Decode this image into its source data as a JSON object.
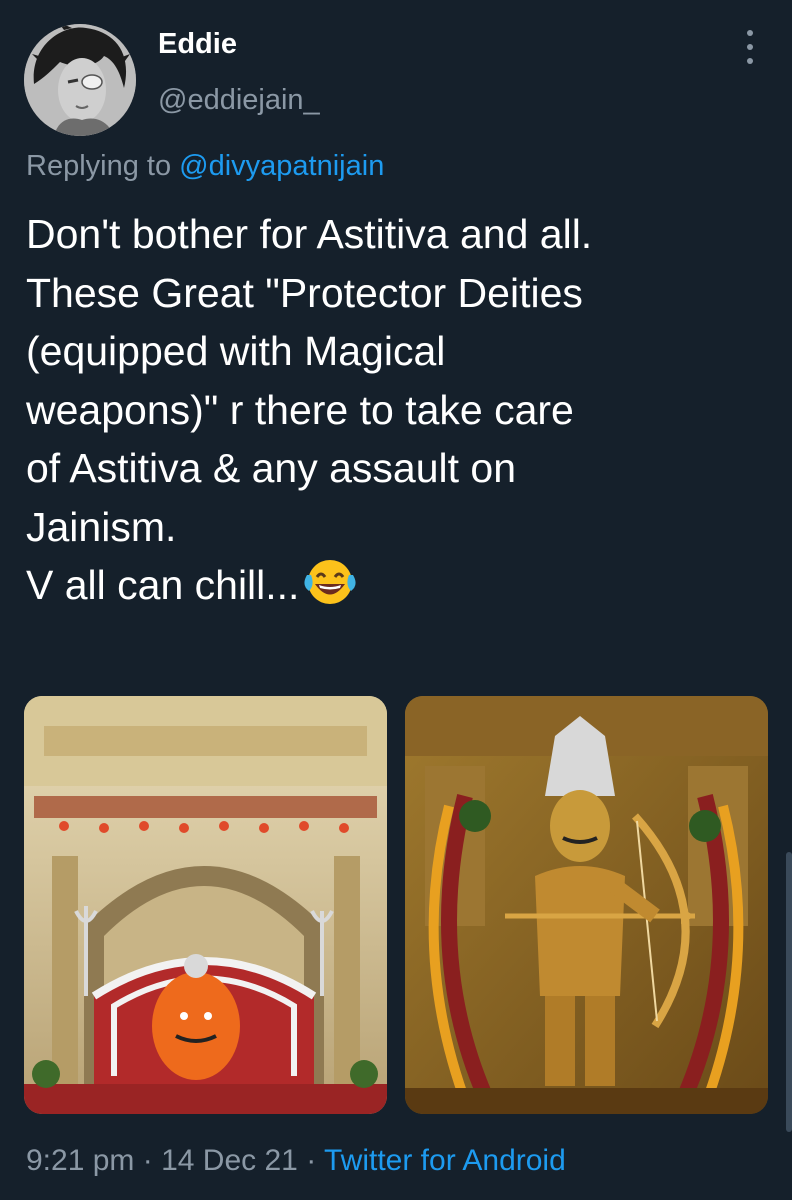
{
  "author": {
    "display_name": "Eddie",
    "handle": "@eddiejain_"
  },
  "reply": {
    "prefix": "Replying to",
    "mention": "@divyapatnijain"
  },
  "tweet": {
    "lines": [
      "Don't bother for Astitiva and all.",
      "These Great \"Protector Deities",
      "(equipped with Magical",
      "weapons)\" r there to take care",
      "of Astitiva & any assault on",
      "Jainism.",
      "V all can chill..."
    ],
    "emoji": "face-with-tears-of-joy"
  },
  "media": [
    {
      "name": "shrine-photo",
      "description_icon": "temple-shrine-image"
    },
    {
      "name": "deity-archer-photo",
      "description_icon": "golden-deity-with-bow-image"
    }
  ],
  "meta": {
    "time": "9:21 pm",
    "separator": "·",
    "date": "14 Dec 21",
    "source": "Twitter for Android"
  },
  "colors": {
    "background": "#15202b",
    "text": "#ffffff",
    "secondary": "#8b98a5",
    "link": "#1d9bf0"
  }
}
